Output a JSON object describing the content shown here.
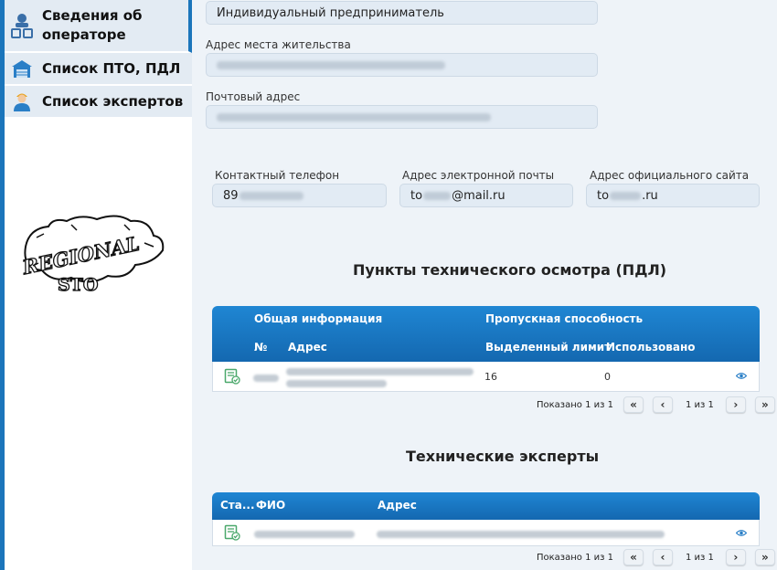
{
  "sidebar": {
    "items": [
      {
        "label_line1": "Сведения об",
        "label_line2": "операторе",
        "icon": "people-icon"
      },
      {
        "label": "Список ПТО, ПДЛ",
        "icon": "building-icon"
      },
      {
        "label": "Список экспертов",
        "icon": "expert-icon"
      }
    ]
  },
  "logo": {
    "line1": "REGIONAL",
    "line2": "STO"
  },
  "form": {
    "legal_form": "Индивидуальный предприниматель",
    "residence_label": "Адрес места жительства",
    "residence_value": "Самарская область, Самара г., Mkrn-ул., 5",
    "postal_label": "Почтовый адрес",
    "postal_value": "443095, Самарская область, Самара г., Mkrn-ул., 5, 63",
    "phone_label": "Контактный телефон",
    "phone_prefix": "89",
    "email_label": "Адрес электронной почты",
    "email_prefix": "to",
    "email_suffix": "@mail.ru",
    "site_label": "Адрес официального сайта",
    "site_prefix": "to",
    "site_suffix": ".ru"
  },
  "pto_section": {
    "title": "Пункты технического осмотра (ПДЛ)",
    "group_general": "Общая информация",
    "group_capacity": "Пропускная способность",
    "col_num": "№",
    "col_address": "Адрес",
    "col_limit": "Выделенный лимит",
    "col_used": "Использовано",
    "rows": [
      {
        "num": "80017",
        "address": "Самарская область, Кинель г., Отрадная мкр., Саровская ул., дом 26,",
        "limit": "16",
        "used": "0"
      }
    ],
    "pager_text": "Показано 1 из 1",
    "page_text": "1 из 1"
  },
  "experts_section": {
    "title": "Технические эксперты",
    "col_status": "Ста...",
    "col_name": "ФИО",
    "col_address": "Адрес",
    "rows": [
      {
        "name": "Цыганов Сергей Юрьевич",
        "address": "Самарская область, Кинель г., Отрадная мкр., Саровская ул., дом 26,"
      }
    ],
    "pager_text": "Показано 1 из 1",
    "page_text": "1 из 1"
  },
  "colors": {
    "accent": "#1b75bb",
    "header_grad_top": "#1f86d3",
    "field_bg": "#e2ebf4",
    "icon_green": "#4aa86b"
  }
}
